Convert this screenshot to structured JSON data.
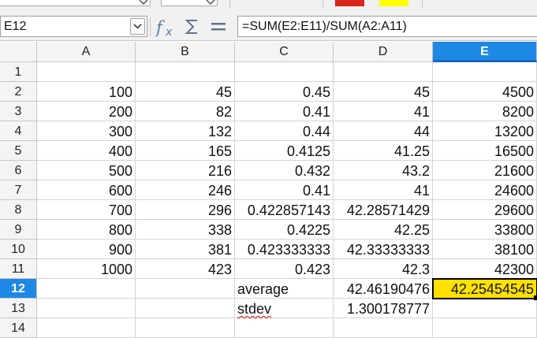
{
  "colors": {
    "swatch_red": "#d9251d",
    "swatch_yellow": "#ffff00",
    "selection_blue": "#1e88e5",
    "active_cell": "#ffe100"
  },
  "formula_bar": {
    "name_box": "E12",
    "formula": "=SUM(E2:E11)/SUM(A2:A11)",
    "icons": [
      "function-wizard-icon",
      "sum-icon",
      "equals-icon"
    ]
  },
  "columns": [
    "A",
    "B",
    "C",
    "D",
    "E"
  ],
  "selected_column": "E",
  "selected_row": "12",
  "rows": [
    {
      "n": "1",
      "cells": [
        "",
        "",
        "",
        "",
        ""
      ]
    },
    {
      "n": "2",
      "cells": [
        "100",
        "45",
        "0.45",
        "45",
        "4500"
      ]
    },
    {
      "n": "3",
      "cells": [
        "200",
        "82",
        "0.41",
        "41",
        "8200"
      ]
    },
    {
      "n": "4",
      "cells": [
        "300",
        "132",
        "0.44",
        "44",
        "13200"
      ]
    },
    {
      "n": "5",
      "cells": [
        "400",
        "165",
        "0.4125",
        "41.25",
        "16500"
      ]
    },
    {
      "n": "6",
      "cells": [
        "500",
        "216",
        "0.432",
        "43.2",
        "21600"
      ]
    },
    {
      "n": "7",
      "cells": [
        "600",
        "246",
        "0.41",
        "41",
        "24600"
      ]
    },
    {
      "n": "8",
      "cells": [
        "700",
        "296",
        "0.422857143",
        "42.28571429",
        "29600"
      ]
    },
    {
      "n": "9",
      "cells": [
        "800",
        "338",
        "0.4225",
        "42.25",
        "33800"
      ]
    },
    {
      "n": "10",
      "cells": [
        "900",
        "381",
        "0.423333333",
        "42.33333333",
        "38100"
      ]
    },
    {
      "n": "11",
      "cells": [
        "1000",
        "423",
        "0.423",
        "42.3",
        "42300"
      ]
    },
    {
      "n": "12",
      "cells": [
        "",
        "",
        "average",
        "42.46190476",
        "42.25454545"
      ]
    },
    {
      "n": "13",
      "cells": [
        "",
        "",
        "stdev",
        "1.300178777",
        ""
      ]
    },
    {
      "n": "14",
      "cells": [
        "",
        "",
        "",
        "",
        ""
      ]
    }
  ]
}
